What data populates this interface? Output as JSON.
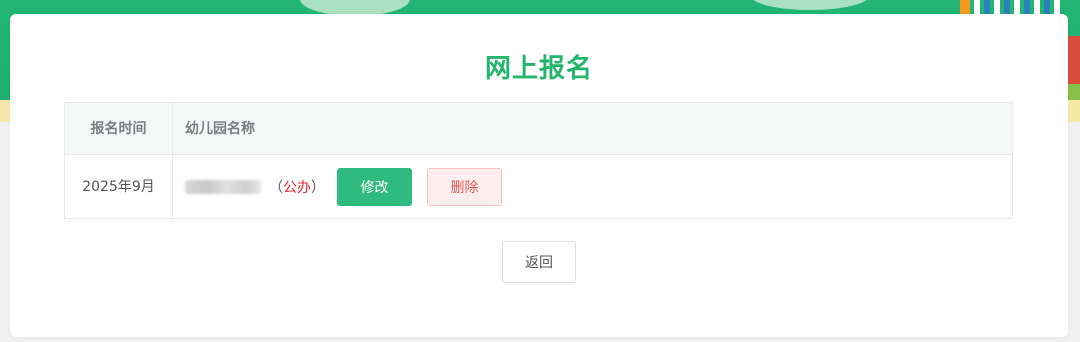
{
  "page": {
    "title": "网上报名"
  },
  "table": {
    "headers": {
      "time": "报名时间",
      "name": "幼儿园名称"
    },
    "rows": [
      {
        "time": "2025年9月",
        "kindergarten_type": "公办",
        "open_paren": "（",
        "close_paren": "）"
      }
    ]
  },
  "actions": {
    "edit_label": "修改",
    "delete_label": "删除",
    "back_label": "返回"
  },
  "colors": {
    "accent": "#23b56b",
    "edit_button": "#2fbb7d",
    "delete_text": "#e25b5b",
    "type_text": "#e0242d"
  }
}
